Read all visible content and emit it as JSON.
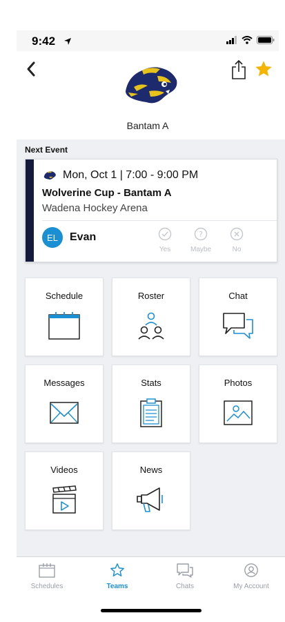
{
  "status": {
    "time": "9:42"
  },
  "header": {
    "team_name": "Bantam A"
  },
  "next_event": {
    "section_label": "Next Event",
    "date": "Mon, Oct 1 | 7:00 - 9:00 PM",
    "title": "Wolverine Cup - Bantam A",
    "location": "Wadena Hockey Arena",
    "player_initials": "EL",
    "player_name": "Evan",
    "rsvp": {
      "yes": "Yes",
      "maybe": "Maybe",
      "no": "No"
    }
  },
  "tiles": {
    "schedule": "Schedule",
    "roster": "Roster",
    "chat": "Chat",
    "messages": "Messages",
    "stats": "Stats",
    "photos": "Photos",
    "videos": "Videos",
    "news": "News"
  },
  "tabbar": {
    "schedules": "Schedules",
    "teams": "Teams",
    "chats": "Chats",
    "account": "My Account"
  },
  "colors": {
    "accent": "#1b8fd4",
    "star": "#f5b400",
    "event_stripe": "#141a3c",
    "background": "#eef0f3"
  },
  "icons": {
    "back": "chevron-left-icon",
    "share": "share-icon",
    "favorite": "star-icon",
    "schedule": "calendar-icon",
    "roster": "people-icon",
    "chat": "chat-bubbles-icon",
    "messages": "envelope-icon",
    "stats": "clipboard-icon",
    "photos": "photo-icon",
    "videos": "clapperboard-icon",
    "news": "megaphone-icon"
  }
}
